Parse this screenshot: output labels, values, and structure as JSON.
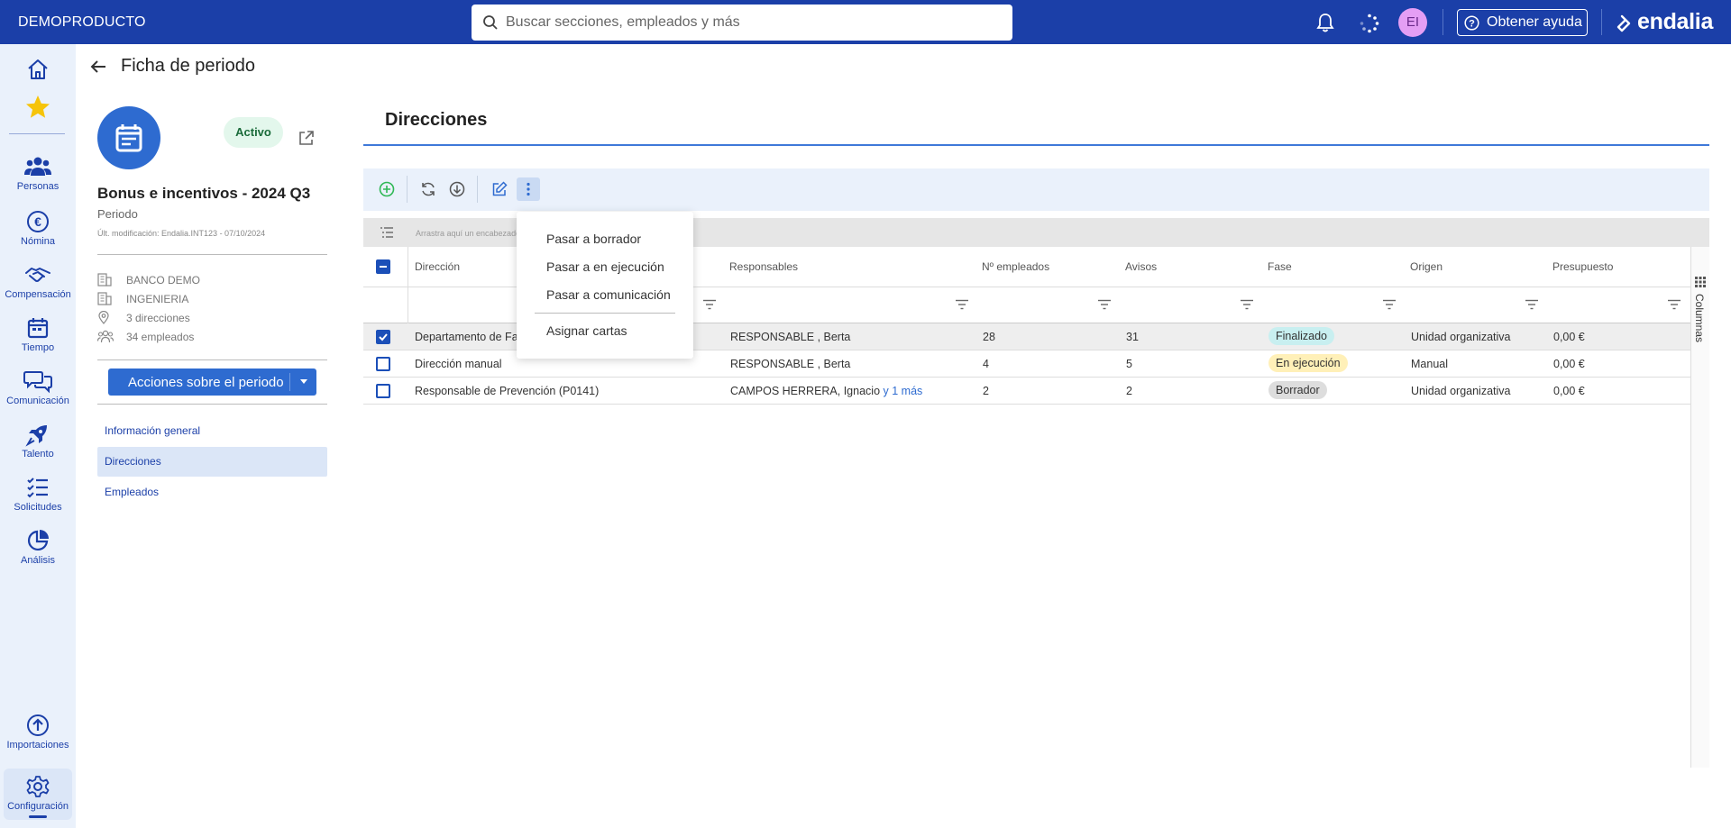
{
  "topbar": {
    "brand": "DEMOPRODUCTO",
    "search_placeholder": "Buscar secciones, empleados y más",
    "avatar_initials": "EI",
    "help_label": "Obtener ayuda",
    "logo_text": "endalia",
    "bg_color": "#1b3fa8"
  },
  "leftnav": {
    "items": [
      {
        "label": "",
        "icon": "home-icon"
      },
      {
        "label": "",
        "icon": "star-icon"
      },
      {
        "label": "Personas",
        "icon": "people-icon"
      },
      {
        "label": "Nómina",
        "icon": "euro-icon"
      },
      {
        "label": "Compensación",
        "icon": "handshake-icon"
      },
      {
        "label": "Tiempo",
        "icon": "calendar-icon"
      },
      {
        "label": "Comunicación",
        "icon": "chat-icon"
      },
      {
        "label": "Talento",
        "icon": "rocket-icon"
      },
      {
        "label": "Solicitudes",
        "icon": "checklist-icon"
      },
      {
        "label": "Análisis",
        "icon": "pie-chart-icon"
      },
      {
        "label": "Importaciones",
        "icon": "upload-icon"
      },
      {
        "label": "Configuración",
        "icon": "gear-icon"
      }
    ]
  },
  "page": {
    "title": "Ficha de periodo"
  },
  "period": {
    "status": "Activo",
    "name": "Bonus e incentivos - 2024 Q3",
    "type": "Periodo",
    "modified": "Últ. modificación: Endalia.INT123 - 07/10/2024",
    "meta": {
      "company": "BANCO DEMO",
      "department": "INGENIERIA",
      "directions": "3 direcciones",
      "employees": "34 empleados"
    },
    "actions_button": "Acciones sobre el periodo"
  },
  "subnav": {
    "items": [
      "Información general",
      "Direcciones",
      "Empleados"
    ],
    "active": "Direcciones"
  },
  "section": {
    "title": "Direcciones",
    "group_hint": "Arrastra aquí un encabezado",
    "columns_label": "Columnas"
  },
  "table": {
    "headers": [
      "Dirección",
      "Responsables",
      "Nº empleados",
      "Avisos",
      "Fase",
      "Origen",
      "Presupuesto"
    ],
    "rows": [
      {
        "direccion": "Departamento de Fa",
        "responsables": "RESPONSABLE , Berta",
        "responsables_more": "",
        "empleados": "28",
        "avisos": "31",
        "fase": "Finalizado",
        "origen": "Unidad organizativa",
        "presupuesto": "0,00 €",
        "selected": true
      },
      {
        "direccion": "Dirección manual",
        "responsables": "RESPONSABLE , Berta",
        "responsables_more": "",
        "empleados": "4",
        "avisos": "5",
        "fase": "En ejecución",
        "origen": "Manual",
        "presupuesto": "0,00 €",
        "selected": false
      },
      {
        "direccion": "Responsable de Prevención (P0141)",
        "responsables": "CAMPOS HERRERA, Ignacio",
        "responsables_more": "y 1 más",
        "empleados": "2",
        "avisos": "2",
        "fase": "Borrador",
        "origen": "Unidad organizativa",
        "presupuesto": "0,00 €",
        "selected": false
      }
    ],
    "phase_colors": {
      "Finalizado": "#c8eff0",
      "En ejecución": "#fff0b8",
      "Borrador": "#dddddd"
    }
  },
  "context_menu": {
    "items": [
      "Pasar a borrador",
      "Pasar a en ejecución",
      "Pasar a comunicación",
      "Asignar cartas"
    ]
  }
}
